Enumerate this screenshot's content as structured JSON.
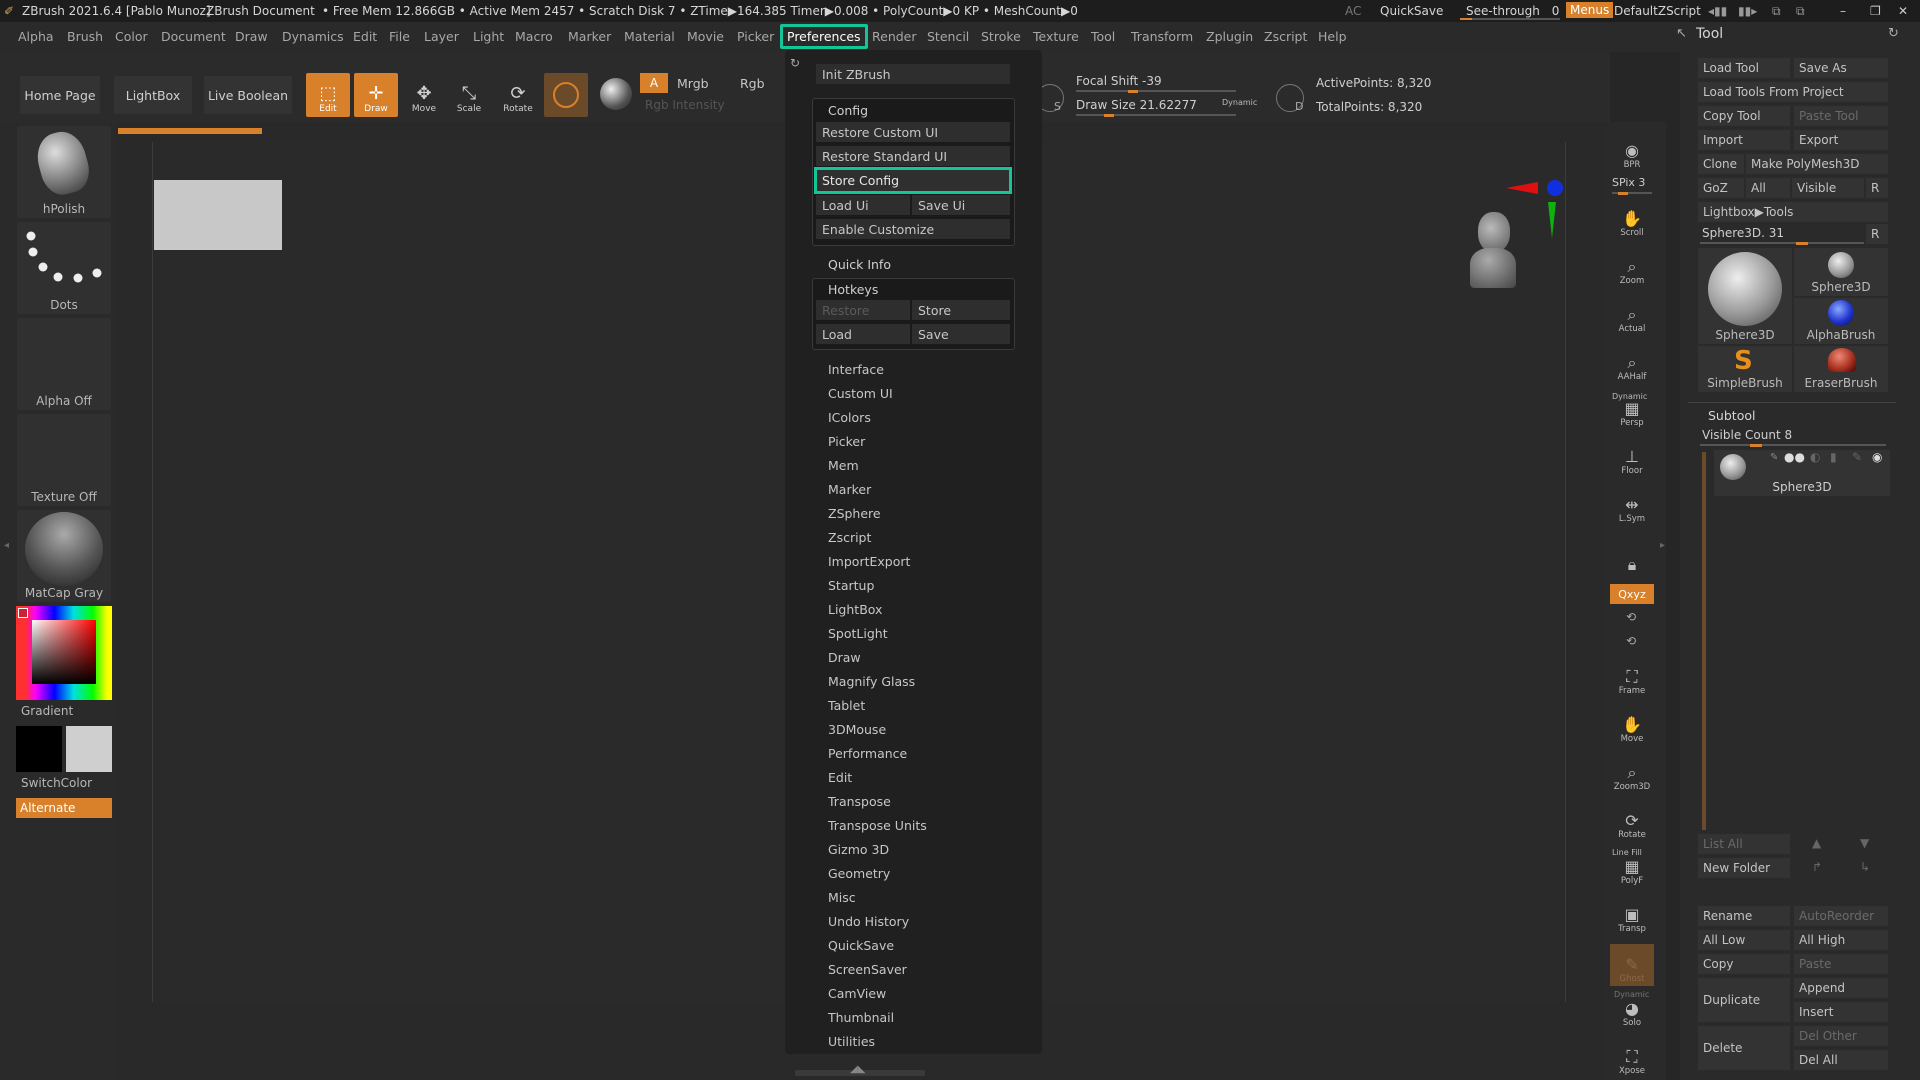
{
  "titlebar": {
    "app": "ZBrush 2021.6.4 [Pablo Munoz]",
    "doc": "ZBrush Document",
    "stats": "• Free Mem 12.866GB • Active Mem 2457 • Scratch Disk 7 • ZTime▶164.385 Timer▶0.008 • PolyCount▶0 KP • MeshCount▶0",
    "ac": "AC",
    "quicksave": "QuickSave",
    "see_through": "See-through",
    "see_through_value": "0",
    "menus": "Menus",
    "zscript": "DefaultZScript"
  },
  "menubar": [
    "Alpha",
    "Brush",
    "Color",
    "Document",
    "Draw",
    "Dynamics",
    "Edit",
    "File",
    "Layer",
    "Light",
    "Macro",
    "Marker",
    "Material",
    "Movie",
    "Picker",
    "Preferences",
    "Render",
    "Stencil",
    "Stroke",
    "Texture",
    "Tool",
    "Transform",
    "Zplugin",
    "Zscript",
    "Help"
  ],
  "shelf": {
    "home": "Home Page",
    "lightbox": "LightBox",
    "liveboolean": "Live Boolean",
    "edit": "Edit",
    "draw": "Draw",
    "move": "Move",
    "scale": "Scale",
    "rotate": "Rotate",
    "a": "A",
    "mrgb": "Mrgb",
    "rgb": "Rgb",
    "rgb_intensity": "Rgb Intensity",
    "focal_shift": "Focal Shift -39",
    "draw_size": "Draw Size 21.62277",
    "dynamic": "Dynamic",
    "active_points": "ActivePoints: 8,320",
    "total_points": "TotalPoints: 8,320"
  },
  "leftshelf": {
    "brush": "hPolish",
    "stroke": "Dots",
    "alpha": "Alpha Off",
    "texture": "Texture Off",
    "material": "MatCap Gray",
    "gradient": "Gradient",
    "switchcolor": "SwitchColor",
    "alternate": "Alternate"
  },
  "rightshelf": {
    "bpr": "BPR",
    "spix": "SPix 3",
    "scroll": "Scroll",
    "zoom": "Zoom",
    "actual": "Actual",
    "aahalf": "AAHalf",
    "dynamic": "Dynamic",
    "persp": "Persp",
    "floor": "Floor",
    "lsym": "L.Sym",
    "xyz": "Qxyz",
    "frame": "Frame",
    "move": "Move",
    "zoom3d": "Zoom3D",
    "rotate": "Rotate",
    "linefill": "Line Fill",
    "polyf": "PolyF",
    "transp": "Transp",
    "ghost": "Ghost",
    "solo": "Solo",
    "dynamic2": "Dynamic",
    "xpose": "Xpose"
  },
  "dropdown": {
    "init": "Init ZBrush",
    "config_label": "Config",
    "restore_custom": "Restore Custom UI",
    "restore_standard": "Restore Standard UI",
    "store_config": "Store Config",
    "load_ui": "Load Ui",
    "save_ui": "Save Ui",
    "enable_customize": "Enable Customize",
    "quick_info": "Quick Info",
    "hotkeys_label": "Hotkeys",
    "hk_restore": "Restore",
    "hk_store": "Store",
    "hk_load": "Load",
    "hk_save": "Save",
    "items": [
      "Interface",
      "Custom UI",
      "IColors",
      "Picker",
      "Mem",
      "Marker",
      "ZSphere",
      "Zscript",
      "ImportExport",
      "Startup",
      "LightBox",
      "SpotLight",
      "Draw",
      "Magnify Glass",
      "Tablet",
      "3DMouse",
      "Performance",
      "Edit",
      "Transpose",
      "Transpose Units",
      "Gizmo 3D",
      "Geometry",
      "Misc",
      "Undo History",
      "QuickSave",
      "ScreenSaver",
      "CamView",
      "Thumbnail",
      "Utilities"
    ]
  },
  "toolpanel": {
    "title": "Tool",
    "load_tool": "Load Tool",
    "save_as": "Save As",
    "load_from_project": "Load Tools From Project",
    "copy_tool": "Copy Tool",
    "paste_tool": "Paste Tool",
    "import": "Import",
    "export": "Export",
    "clone": "Clone",
    "make_polymesh": "Make PolyMesh3D",
    "goz": "GoZ",
    "all": "All",
    "visible": "Visible",
    "r": "R",
    "lightbox_tools": "Lightbox▶Tools",
    "sphere_slider": "Sphere3D. 31",
    "r2": "R",
    "thumbs": [
      "Sphere3D",
      "Sphere3D",
      "AlphaBrush",
      "SimpleBrush",
      "EraserBrush"
    ],
    "subtool_title": "Subtool",
    "visible_count": "Visible Count 8",
    "subtool_name": "Sphere3D",
    "list_all": "List All",
    "new_folder": "New Folder",
    "rename": "Rename",
    "autoreorder": "AutoReorder",
    "all_low": "All Low",
    "all_high": "All High",
    "copy": "Copy",
    "paste": "Paste",
    "duplicate": "Duplicate",
    "append": "Append",
    "insert": "Insert",
    "delete": "Delete",
    "del_other": "Del Other",
    "del_all": "Del All"
  },
  "colors": {
    "accent": "#d8812a",
    "highlight": "#16c49a"
  }
}
